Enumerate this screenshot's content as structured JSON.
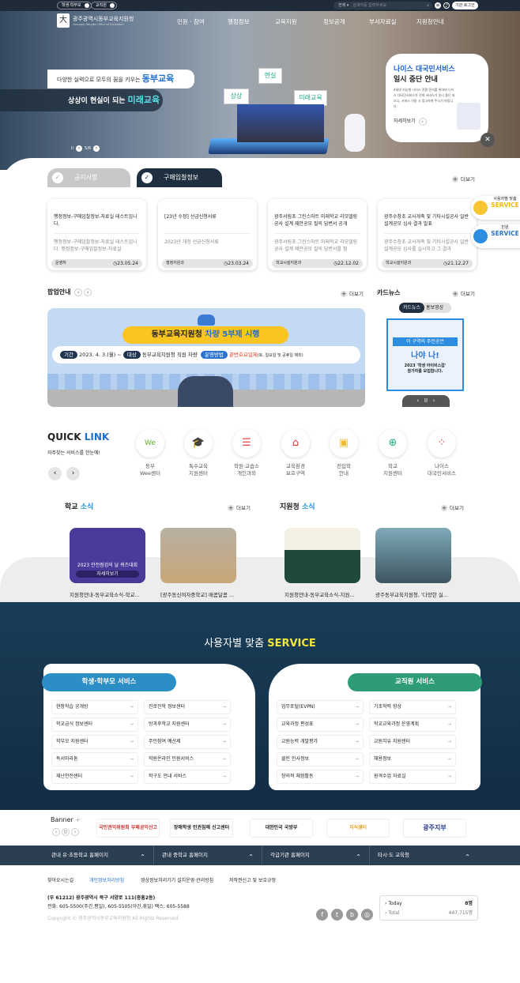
{
  "topbar": {
    "user_toggles": [
      "학생·학부모",
      "교직원"
    ],
    "search_scope": "전체",
    "search_placeholder": "검색어를 입력하세요",
    "login": "기관 로그인"
  },
  "header": {
    "logo_title": "광주광역시동부교육지원청",
    "logo_subtitle": "Gwangju Dongbu Office of Education",
    "nav": [
      "민원 · 참여",
      "행정정보",
      "교육지원",
      "정보공개",
      "부서자료실",
      "지원청안내"
    ]
  },
  "hero": {
    "slogan1": "다양한 실력으로 모두의 꿈을 키우는",
    "slogan1_brand": "동부교육",
    "slogan2": "상상이 현실이 되는",
    "slogan2_brand": "미래교육",
    "signs": [
      "상상",
      "현실",
      "미래교육"
    ],
    "slide_counter": "5/6",
    "popup": {
      "title1": "나이스 대국민서비스",
      "title2": "일시 중단 안내",
      "desc": "4세대 지능형 나이스 전환 준비를 위하여 나이스 대국민서비스가 전체 서비스가 일시 중단 되오니, 서비스 이용 시 참고하여 주시기 바랍니다.",
      "detail": "자세히보기"
    }
  },
  "notice": {
    "tabs": [
      "공지사항",
      "구매입찰정보"
    ],
    "active_tab": 1,
    "more": "더보기",
    "cards": [
      {
        "title": "행정정보-구매입찰정보-자료실 테스트입니다.",
        "desc": "행정정보-구매입찰정보-자료실 테스트입니다. 행정정보-구매입찰정보-자료실",
        "dept": "운영자",
        "date": "23.05.24"
      },
      {
        "title": "[23년 수정] 선금신청서류",
        "desc": "2023년 개정 선금신청서류",
        "dept": "행정지원과",
        "date": "23.03.24"
      },
      {
        "title": "광주서림초 그린스마트 미래학교 리모델링공사 설계 제안공모 질의 답변서 공개",
        "desc": "광주서림초 그린스마트 미래학교 리모델링공사 설계 제안공모 질의 답변서를 첨",
        "dept": "학교시설지원과",
        "date": "22.12.02"
      },
      {
        "title": "광주수창초 교사개축 및 기타시설공사 일반 설계공모 심사 결과 발표",
        "desc": "광주수창초 교사개축 및 기타시설공사 일반 설계공모 심사를 실시하고 그 결과",
        "dept": "학교시설지원과",
        "date": "21.12.27"
      }
    ]
  },
  "side_buttons": [
    {
      "label": "사용자별 맞춤",
      "title": "SERVICE"
    },
    {
      "label": "민원",
      "title": "SERVICE"
    }
  ],
  "popup_section": {
    "title": "팝업안내",
    "more": "더보기",
    "banner": {
      "headline": "동부교육지원청",
      "headline_hl": "차량 5부제 시행",
      "period_label": "기간",
      "period": "2023. 4. 3.(월) ~",
      "target_label": "대상",
      "target": "동부교육지원청 직원 차량",
      "method_label": "운영방법",
      "method_hl": "끝번호요일제",
      "method": "(토, 일요일 및 공휴일 제외)"
    }
  },
  "cardnews": {
    "title": "카드뉴스",
    "more": "더보기",
    "tabs": [
      "카드뉴스",
      "홍보영상"
    ],
    "line1": "이 구역의 주인공은",
    "line2": "나야 나!",
    "line3": "2023 '학생 아이비스컵'",
    "line4": "참가자를 모집합니다."
  },
  "quicklink": {
    "title1": "QUICK",
    "title2": "LINK",
    "subtitle": "자주찾는 서비스를 한눈에!",
    "items": [
      {
        "label1": "동부",
        "label2": "Wee센터",
        "icon": "wee-icon"
      },
      {
        "label1": "특수교육",
        "label2": "지원센터",
        "icon": "graduation-cap-icon"
      },
      {
        "label1": "학원·교습소",
        "label2": "개인과외",
        "icon": "books-icon"
      },
      {
        "label1": "교육환경",
        "label2": "보호구역",
        "icon": "school-icon"
      },
      {
        "label1": "전입학",
        "label2": "안내",
        "icon": "bus-icon"
      },
      {
        "label1": "학교",
        "label2": "지원센터",
        "icon": "globe-icon"
      },
      {
        "label1": "나이스",
        "label2": "대국민서비스",
        "icon": "dots-icon"
      }
    ]
  },
  "school_news": {
    "title1": "학교",
    "title2": "소식",
    "more": "더보기",
    "items": [
      {
        "title": "지원청안내-동부교육소식-학교...",
        "date": "23-05-24",
        "img_text": "2023 안전점검의 날 퀴즈대회",
        "img_btn": "자세히보기"
      },
      {
        "title": "[광주동신여자중학교] 매콤달콤 ...",
        "date": "23-03-30"
      }
    ]
  },
  "office_news": {
    "title1": "지원청",
    "title2": "소식",
    "more": "더보기",
    "items": [
      {
        "title": "지원청안내-동부교육소식-지원...",
        "date": "23-05-24"
      },
      {
        "title": "광주동부교육지원청, '다양한 실...",
        "date": "23-03-31"
      }
    ]
  },
  "service": {
    "title": "사용자별 맞춤",
    "title_hl": "SERVICE",
    "student": {
      "title": "학생·학부모 서비스",
      "color": "#2b8fc6",
      "items": [
        "현장학습 공개방",
        "진로진학 정보센터",
        "학교급식 정보센터",
        "방과후학교 지원센터",
        "학부모 지원센터",
        "주민참여 예산제",
        "독서마라톤",
        "학원온라인 민원서비스",
        "재난안전센터",
        "학구도 안내 서비스"
      ]
    },
    "staff": {
      "title": "교직원 서비스",
      "color": "#2f9c78",
      "items": [
        "업무포털(EVPN)",
        "기초학력 향상",
        "교육과정 편성표",
        "학교교육과정 운영계획",
        "교원능력 개발평가",
        "교원치유 지원센터",
        "클린 인사정보",
        "채용정보",
        "창의적 체험활동",
        "원격수업 자료실"
      ]
    }
  },
  "banner": {
    "title": "Banner",
    "items": [
      "국민권익위원회 부패공익신고",
      "장애학생 인권침해 신고센터",
      "대한민국 국방부",
      "지식샘터",
      "광주지부"
    ]
  },
  "footer_nav": [
    "관내 유·초등학교 홈페이지",
    "관내 중학교 홈페이지",
    "각급기관 홈페이지",
    "타시·도 교육청"
  ],
  "footer": {
    "links": [
      "찾아오시는길",
      "개인정보처리방침",
      "영상정보처리기기 설치운영·관리방침",
      "저작권신고 및 보호규정"
    ],
    "address": "(우 61212) 광주광역시 북구 서양로 111(중흥2동)",
    "phone": "전화: 605-5500(주간,평일), 605-5505(야간,휴일)  팩스: 605-5588",
    "copyright": "Copyright © 광주광역시동부교육지원청 All Rights Reserved.",
    "today_label": "Today",
    "today": "8명",
    "total_label": "Total",
    "total": "447,715명"
  }
}
